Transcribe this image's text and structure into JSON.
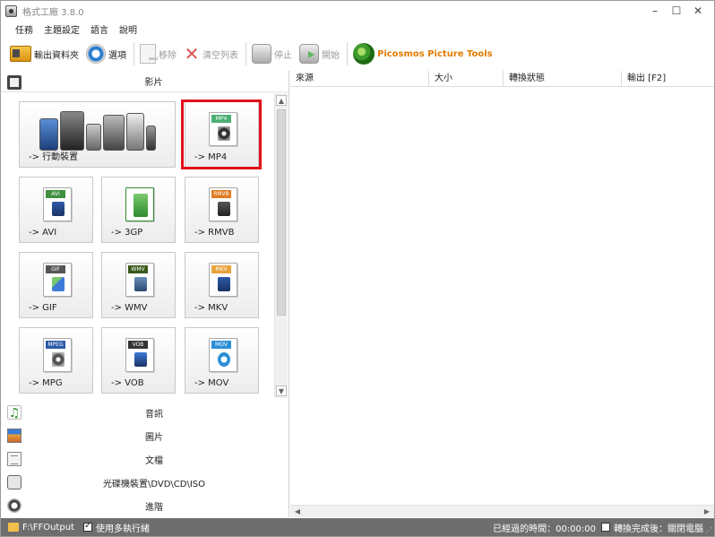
{
  "window": {
    "title": "格式工廠 3.8.0",
    "controls": {
      "minimize": "–",
      "maximize": "☐",
      "close": "✕"
    }
  },
  "menu": {
    "items": [
      "任務",
      "主題設定",
      "語言",
      "說明"
    ]
  },
  "toolbar": {
    "output_folder": "輸出資料夾",
    "options": "選項",
    "remove": "移除",
    "clear_list": "清空列表",
    "stop": "停止",
    "start": "開始",
    "picosmos": "Picosmos Picture Tools"
  },
  "categories": {
    "video": "影片",
    "audio": "音訊",
    "picture": "圖片",
    "document": "文檔",
    "disc": "光碟機裝置\\DVD\\CD\\ISO",
    "advanced": "進階"
  },
  "formats": [
    {
      "label": "-> 行動裝置",
      "tag": "",
      "color": "#555555"
    },
    {
      "label": "-> MP4",
      "tag": "MP4",
      "color": "#4caf73"
    },
    {
      "label": "-> AVI",
      "tag": "AVI",
      "color": "#3f8f3f"
    },
    {
      "label": "-> 3GP",
      "tag": "",
      "color": "#2e8b2e"
    },
    {
      "label": "-> RMVB",
      "tag": "RMVB",
      "color": "#e07b22"
    },
    {
      "label": "-> GIF",
      "tag": "GIF",
      "color": "#555555"
    },
    {
      "label": "-> WMV",
      "tag": "WMV",
      "color": "#3a5a1a"
    },
    {
      "label": "-> MKV",
      "tag": "MKV",
      "color": "#e8a33c"
    },
    {
      "label": "-> MPG",
      "tag": "MPEG",
      "color": "#2d5aa8"
    },
    {
      "label": "-> VOB",
      "tag": "VOB",
      "color": "#333333"
    },
    {
      "label": "-> MOV",
      "tag": "MOV",
      "color": "#2b8fd6"
    }
  ],
  "task_list": {
    "columns": [
      "來源",
      "大小",
      "轉換狀態",
      "輸出 [F2]"
    ]
  },
  "status": {
    "output_path": "F:\\FFOutput",
    "multithread": "使用多執行緒",
    "elapsed": "已經過的時間：00:00:00",
    "after_convert": "轉換完成後：關閉電腦"
  },
  "colors": {
    "selection": "#e2111a",
    "statusbar": "#6e6e6e",
    "picosmos": "#e07b00"
  }
}
